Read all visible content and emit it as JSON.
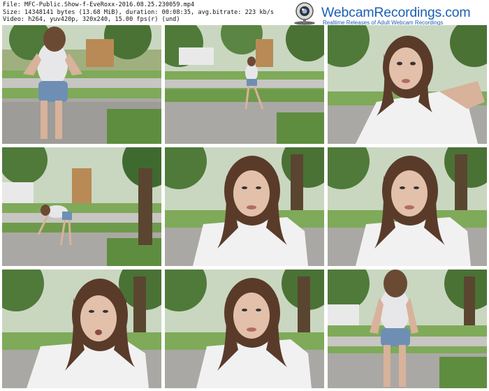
{
  "file_info": {
    "line1": "File: MFC-Public.Show-f-EveRoxx-2016.08.25.230059.mp4",
    "line2": "Size: 14348141 bytes (13.68 MiB), duration: 00:08:35, avg.bitrate: 223 kb/s",
    "line3": "Video: h264, yuv420p, 320x240, 15.00 fps(r) (und)"
  },
  "brand": {
    "title": "WebcamRecordings.com",
    "tagline": "Realtime Releases of Adult Webcam Recordings",
    "color": "#1d5fb5"
  },
  "thumbnails": [
    {
      "scene": "street-standing-back"
    },
    {
      "scene": "street-standing-far"
    },
    {
      "scene": "closeup-selfie"
    },
    {
      "scene": "street-bending"
    },
    {
      "scene": "closeup-face"
    },
    {
      "scene": "closeup-face"
    },
    {
      "scene": "closeup-face-talking"
    },
    {
      "scene": "closeup-face"
    },
    {
      "scene": "street-standing-back"
    }
  ]
}
